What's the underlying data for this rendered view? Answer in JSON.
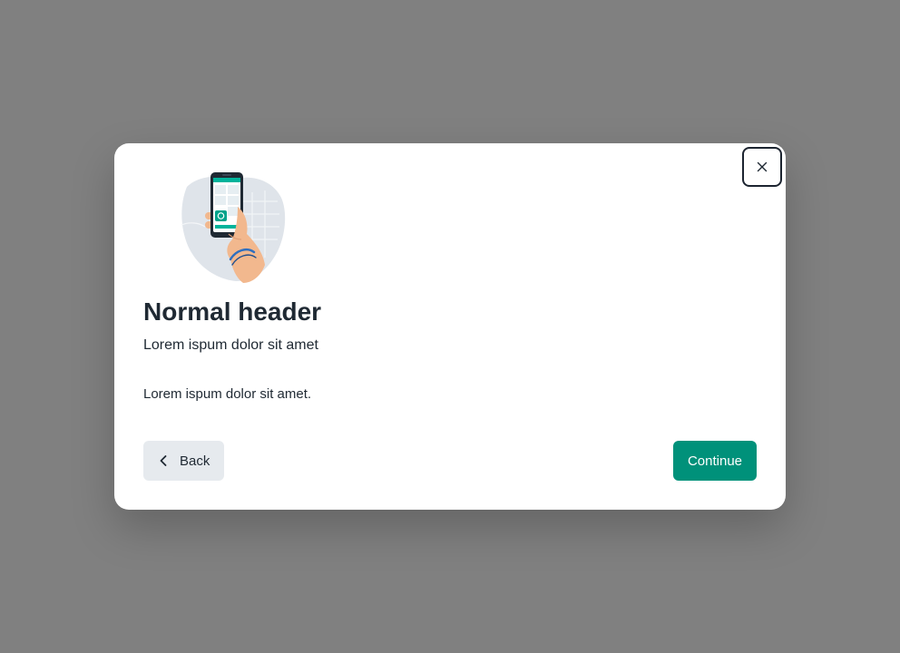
{
  "modal": {
    "title": "Normal header",
    "subtitle": "Lorem ispum dolor sit amet",
    "body": "Lorem ispum dolor sit amet.",
    "close_icon": "close-icon",
    "illustration_icon": "phone-in-hand-illustration"
  },
  "footer": {
    "back_label": "Back",
    "back_icon": "chevron-left-icon",
    "continue_label": "Continue"
  },
  "colors": {
    "accent": "#00917a",
    "overlay": "#808080",
    "secondary_button": "#e6eaee",
    "text": "#1f2933"
  }
}
